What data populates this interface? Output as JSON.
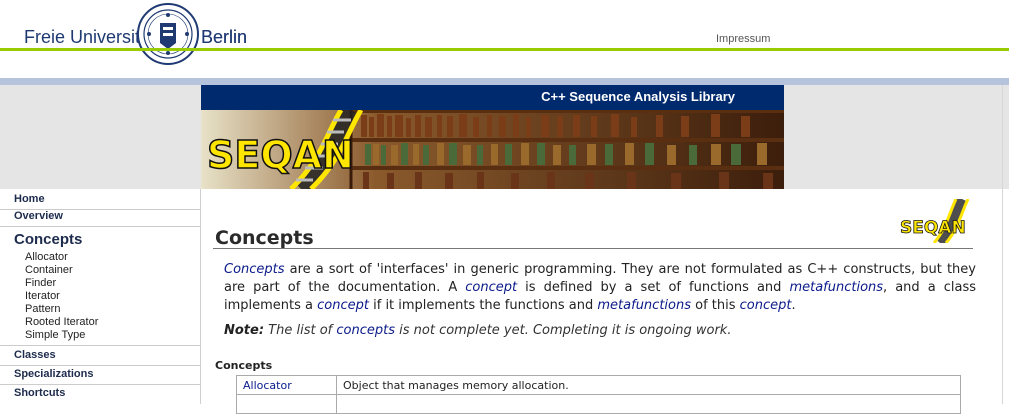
{
  "header": {
    "uni_left": "Freie Universität",
    "uni_right": "Berlin",
    "impressum": "Impressum"
  },
  "banner": {
    "title": "C++ Sequence Analysis Library",
    "logo_text": "SEQAN"
  },
  "sidebar": {
    "items": [
      {
        "label": "Home"
      },
      {
        "label": "Overview"
      }
    ],
    "current": "Concepts",
    "sub_items": [
      "Allocator",
      "Container",
      "Finder",
      "Iterator",
      "Pattern",
      "Rooted Iterator",
      "Simple Type"
    ],
    "bottom_items": [
      "Classes",
      "Specializations",
      "Shortcuts"
    ]
  },
  "main": {
    "title": "Concepts",
    "p1": {
      "s0": "Concepts",
      "s1": " are a sort of 'interfaces' in generic programming. They are not formulated as C++ constructs, but they are part of the documentation. A ",
      "s2": "concept",
      "s3": " is defined by a set of functions and ",
      "s4": "metafunctions",
      "s5": ", and a class implements a ",
      "s6": "concept",
      "s7": " if it implements the functions and ",
      "s8": "metafunctions",
      "s9": " of this ",
      "s10": "concept",
      "s11": "."
    },
    "note": {
      "label": "Note:",
      "t1": " The list of ",
      "link": "concepts",
      "t2": " is not complete yet. Completing it is ongoing work."
    },
    "section_heading": "Concepts",
    "table": [
      {
        "name": "Allocator",
        "desc": "Object that manages memory allocation."
      },
      {
        "name": "",
        "desc": ""
      }
    ]
  },
  "colors": {
    "accent_green": "#99cc00",
    "navy": "#002a6e",
    "link": "#0b1b8a"
  }
}
